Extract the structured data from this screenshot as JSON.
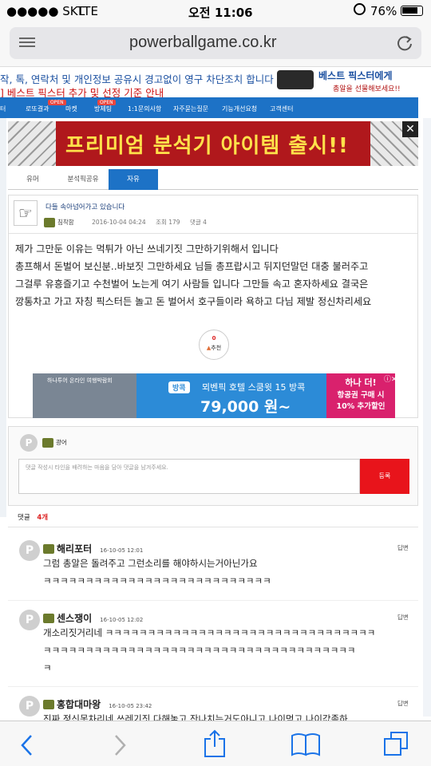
{
  "status": {
    "signal": "●●●●● SKT",
    "network": "LTE",
    "time": "오전 11:06",
    "battery": "76%"
  },
  "browser": {
    "url": "powerballgame.co.kr"
  },
  "notice": {
    "line1": "작, 톡, 연락처 및 개인정보 공유시 경고없이 영구 차단조치 합니다",
    "line2": "] 베스트 픽스터 추가 및 선정 기준 안내",
    "ad_title": "베스트 픽스터에게",
    "ad_sub": "총알을 선물해보세요!!"
  },
  "nav": {
    "items": [
      "터",
      "로또결과",
      "마켓",
      "방제팅",
      "1:1문의사항",
      "자주묻는질문",
      "기능개선요청",
      "고객센터"
    ],
    "badge": "OPEN"
  },
  "promo": {
    "text": "프리미엄 분석기 아이템 출시!!"
  },
  "tabs": [
    "유머",
    "분석픽공유",
    "자유"
  ],
  "post": {
    "title": "다들 속아넘어가고 있습니다",
    "author": "침착함",
    "date": "2016-10-04 04:24",
    "views_label": "조회 179",
    "comments_label": "댓글 4",
    "body": [
      "제가 그만둔 이유는 먹튀가 아닌 쓰네기짓 그만하기위해서 입니다",
      "총프해서 돈벌어 보신분..바보짓 그만하세요 님들 총프랍시고 뒤지던말던 대충 불러주고",
      "그걸루 유흥즐기고 수천벌어 노는게 여기 사람들 입니다 그만들 속고 혼자하세요 결국은",
      "깡통차고 가고 자칭 픽스터든 놀고 돈 벌어서 호구들이라 욕하고 다님 제발 정신차리세요"
    ],
    "recommend_count": "0",
    "recommend_label": "추천"
  },
  "ad": {
    "small": "하나투어 온라인 여행박람회",
    "tag": "방콕",
    "headline": "뫼벤픽 호텔 스쿰윗 15 방콕",
    "price": "79,000 원~",
    "brand": "하나 더!",
    "brand_sub1": "항공권 구매 시",
    "brand_sub2": "10% 추가할인"
  },
  "comment_form": {
    "user": "광어",
    "placeholder": "댓글 작성시 타인을 배려하는 마음을 담아 댓글을 남겨주세요.",
    "submit": "등록"
  },
  "comments_header": {
    "label": "댓글",
    "count": "4개"
  },
  "comments": [
    {
      "name": "해리포터",
      "time": "16-10-05 12:01",
      "reply": "답변",
      "lines": [
        "그럼 총알은 돌려주고 그런소리를 해야하시는거아닌가요",
        "ㅋㅋㅋㅋㅋㅋㅋㅋㅋㅋㅋㅋㅋㅋㅋㅋㅋㅋㅋㅋㅋㅋㅋㅋㅋㅋㅋ"
      ]
    },
    {
      "name": "센스쟁이",
      "time": "16-10-05 12:02",
      "reply": "답변",
      "lines": [
        "개소리짓거리네 ㅋㅋㅋㅋㅋㅋㅋㅋㅋㅋㅋㅋㅋㅋㅋㅋㅋㅋㅋㅋㅋㅋㅋㅋㅋㅋㅋㅋㅋㅋㅋㅋ",
        "ㅋㅋㅋㅋㅋㅋㅋㅋㅋㅋㅋㅋㅋㅋㅋㅋㅋㅋㅋㅋㅋㅋㅋㅋㅋㅋㅋㅋㅋㅋㅋㅋㅋㅋㅋㅋㅋ",
        "ㅋ"
      ]
    },
    {
      "name": "홍합대마왕",
      "time": "16-10-05 23:42",
      "reply": "답변",
      "lines": [
        "진짜 정신못차리네 쓰레기짓 다해놓고 잔나치는거도아니고 나이먹고 나이값좀하"
      ]
    }
  ]
}
